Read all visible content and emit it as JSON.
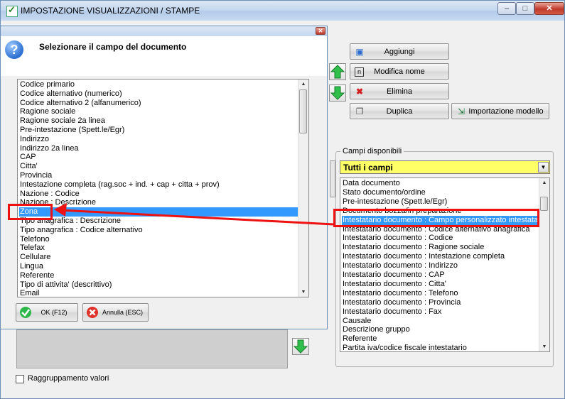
{
  "main_window": {
    "title": "IMPOSTAZIONE VISUALIZZAZIONI / STAMPE",
    "controls": {
      "minimize": "–",
      "maximize": "□",
      "close": "✕"
    }
  },
  "toolbar": {
    "add_label": "Aggiungi",
    "rename_label": "Modifica nome",
    "delete_label": "Elimina",
    "duplicate_label": "Duplica",
    "import_model_label": "Importazione modello"
  },
  "available_fields": {
    "group_title": "Campi disponibili",
    "filter_selected": "Tutti i campi",
    "selected_index": 4,
    "items": [
      "Data documento",
      "Stato documento/ordine",
      "Pre-intestazione (Spett.le/Egr)",
      "Documento bozza/in preparazione",
      "Intestatario documento : Campo personalizzato intestatario",
      "Intestatario documento : Codice alternativo anagrafica",
      "Intestatario documento : Codice",
      "Intestatario documento : Ragione sociale",
      "Intestatario documento : Intestazione completa",
      "Intestatario documento : Indirizzo",
      "Intestatario documento : CAP",
      "Intestatario documento : Citta'",
      "Intestatario documento : Telefono",
      "Intestatario documento : Provincia",
      "Intestatario documento : Fax",
      "Causale",
      "Descrizione gruppo",
      "Referente",
      "Partita iva/codice fiscale intestatario"
    ]
  },
  "grouping_checkbox_label": "Raggruppamento valori",
  "dialog": {
    "heading": "Selezionare il campo del documento",
    "selected_index": 14,
    "ok_label": "OK (F12)",
    "cancel_label": "Annulla (ESC)",
    "items": [
      "Codice primario",
      "Codice alternativo (numerico)",
      "Codice alternativo 2 (alfanumerico)",
      "Ragione sociale",
      "Ragione sociale 2a linea",
      "Pre-intestazione (Spett.le/Egr)",
      "Indirizzo",
      "Indirizzo 2a linea",
      "CAP",
      "Citta'",
      "Provincia",
      "Intestazione completa (rag.soc + ind. + cap + citta + prov)",
      "Nazione : Codice",
      "Nazione : Descrizione",
      "Zona",
      "Tipo anagrafica : Descrizione",
      "Tipo anagrafica : Codice alternativo",
      "Telefono",
      "Telefax",
      "Cellulare",
      "Lingua",
      "Referente",
      "Tipo di attivita' (descrittivo)",
      "Email"
    ]
  },
  "colors": {
    "selection": "#3399ff",
    "filter_bg": "#ffff66",
    "annotation": "#ee1111"
  }
}
